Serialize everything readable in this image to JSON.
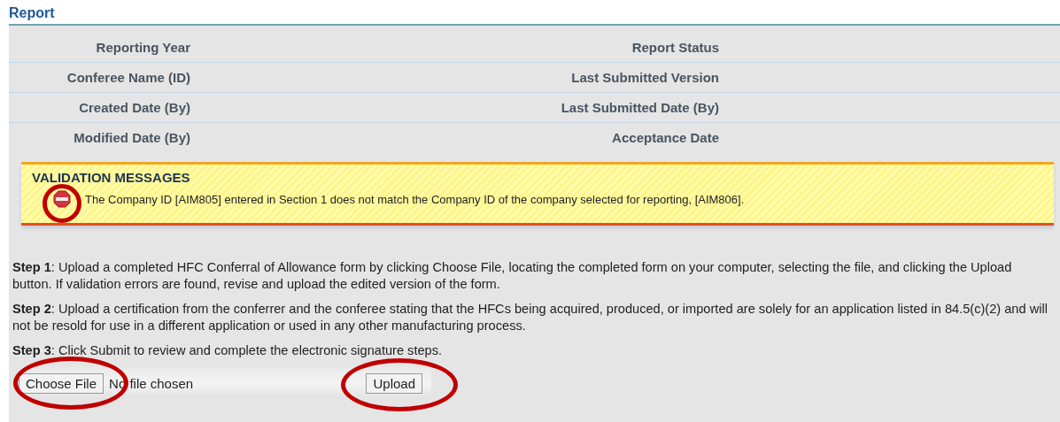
{
  "title": "Report",
  "fields": [
    {
      "left": "Reporting Year",
      "right": "Report Status"
    },
    {
      "left": "Conferee Name (ID)",
      "right": "Last Submitted Version"
    },
    {
      "left": "Created Date (By)",
      "right": "Last Submitted Date (By)"
    },
    {
      "left": "Modified Date (By)",
      "right": "Acceptance Date"
    }
  ],
  "validation": {
    "heading": "VALIDATION MESSAGES",
    "messages": [
      {
        "kind": "error",
        "text": "The Company ID [AIM805] entered in Section 1 does not match the Company ID of the company selected for reporting, [AIM806]."
      }
    ]
  },
  "steps": [
    "**Step 1**: Upload a completed HFC Conferral of Allowance form by clicking Choose File, locating the completed form on your computer, selecting the file, and clicking the Upload button. If validation errors are found, revise and upload the edited version of the form.",
    "**Step 2**: Upload a certification from the conferrer and the conferee stating that the HFCs being acquired, produced, or imported are solely for an application listed in 84.5(c)(2) and will not be resold for use in a different application or used in any other manufacturing process.",
    "**Step 3**: Click Submit to review and complete the electronic signature steps."
  ],
  "upload": {
    "choose_button": "Choose File",
    "file_status": "No file chosen",
    "upload_button": "Upload"
  }
}
